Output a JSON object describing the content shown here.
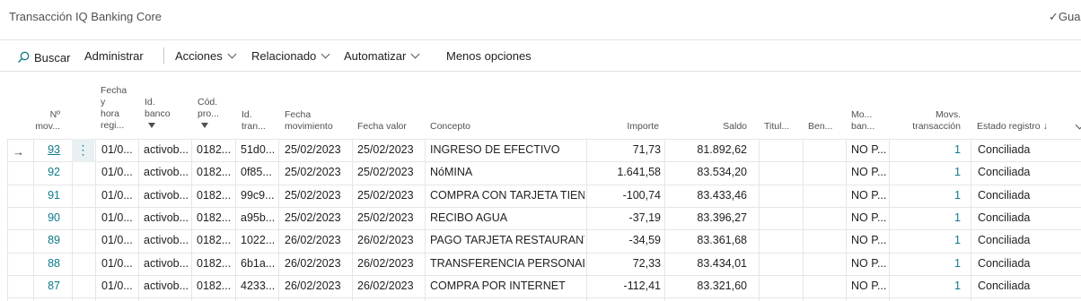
{
  "page": {
    "title": "Transacción IQ Banking Core",
    "save_label": "✓Gua"
  },
  "toolbar": {
    "search": "Buscar",
    "manage": "Administrar",
    "actions": "Acciones",
    "related": "Relacionado",
    "automate": "Automatizar",
    "fewer": "Menos opciones"
  },
  "columns": {
    "mov_no": [
      "Nº",
      "mov..."
    ],
    "fecha_hora": [
      "Fecha",
      "y",
      "hora",
      "regi..."
    ],
    "id_banco": [
      "Id.",
      "banco"
    ],
    "cod_pro": [
      "Cód.",
      "pro..."
    ],
    "id_tran": [
      "Id.",
      "tran..."
    ],
    "fecha_mov": [
      "Fecha",
      "movimiento"
    ],
    "fecha_valor": "Fecha valor",
    "concepto": "Concepto",
    "importe": "Importe",
    "saldo": "Saldo",
    "titular": "Titul...",
    "ben": "Ben...",
    "mo_ban": [
      "Mo...",
      "ban..."
    ],
    "movs_trans": [
      "Movs.",
      "transacción"
    ],
    "estado": "Estado registro ↓"
  },
  "rows": [
    {
      "no": "93",
      "fecha": "01/0...",
      "banco": "activob...",
      "cod": "0182...",
      "tran": "51d0...",
      "fmov": "25/02/2023",
      "fval": "25/02/2023",
      "concepto": "INGRESO DE EFECTIVO",
      "importe": "71,73",
      "saldo": "81.892,62",
      "mo": "NO P...",
      "movs": "1",
      "estado": "Conciliada"
    },
    {
      "no": "92",
      "fecha": "01/0...",
      "banco": "activob...",
      "cod": "0182...",
      "tran": "0f85...",
      "fmov": "25/02/2023",
      "fval": "25/02/2023",
      "concepto": "NóMINA",
      "importe": "1.641,58",
      "saldo": "83.534,20",
      "mo": "NO P...",
      "movs": "1",
      "estado": "Conciliada"
    },
    {
      "no": "91",
      "fecha": "01/0...",
      "banco": "activob...",
      "cod": "0182...",
      "tran": "99c9...",
      "fmov": "25/02/2023",
      "fval": "25/02/2023",
      "concepto": "COMPRA CON TARJETA TIEN...",
      "importe": "-100,74",
      "saldo": "83.433,46",
      "mo": "NO P...",
      "movs": "1",
      "estado": "Conciliada"
    },
    {
      "no": "90",
      "fecha": "01/0...",
      "banco": "activob...",
      "cod": "0182...",
      "tran": "a95b...",
      "fmov": "25/02/2023",
      "fval": "25/02/2023",
      "concepto": "RECIBO AGUA",
      "importe": "-37,19",
      "saldo": "83.396,27",
      "mo": "NO P...",
      "movs": "1",
      "estado": "Conciliada"
    },
    {
      "no": "89",
      "fecha": "01/0...",
      "banco": "activob...",
      "cod": "0182...",
      "tran": "1022...",
      "fmov": "26/02/2023",
      "fval": "26/02/2023",
      "concepto": "PAGO TARJETA RESTAURANTE",
      "importe": "-34,59",
      "saldo": "83.361,68",
      "mo": "NO P...",
      "movs": "1",
      "estado": "Conciliada"
    },
    {
      "no": "88",
      "fecha": "01/0...",
      "banco": "activob...",
      "cod": "0182...",
      "tran": "6b1a...",
      "fmov": "26/02/2023",
      "fval": "26/02/2023",
      "concepto": "TRANSFERENCIA PERSONAL",
      "importe": "72,33",
      "saldo": "83.434,01",
      "mo": "NO P...",
      "movs": "1",
      "estado": "Conciliada"
    },
    {
      "no": "87",
      "fecha": "01/0...",
      "banco": "activob...",
      "cod": "0182...",
      "tran": "4233...",
      "fmov": "26/02/2023",
      "fval": "26/02/2023",
      "concepto": "COMPRA POR INTERNET",
      "importe": "-112,41",
      "saldo": "83.321,60",
      "mo": "NO P...",
      "movs": "1",
      "estado": "Conciliada"
    }
  ],
  "colors": {
    "link": "#0f7a8a",
    "text": "#212121",
    "muted": "#505050",
    "selected_cell": "#e8f0f2"
  },
  "icons": {
    "search": "search-icon",
    "arrow": "current-row-arrow-icon",
    "filter": "filter-icon",
    "more": "row-actions-icon"
  }
}
